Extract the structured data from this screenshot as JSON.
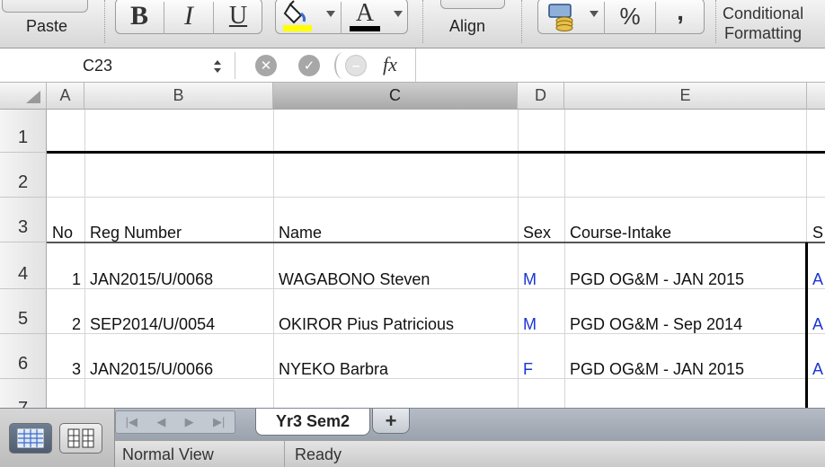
{
  "ribbon": {
    "paste_label": "Paste",
    "bold_label": "B",
    "italic_label": "I",
    "underline_label": "U",
    "font_color_label": "A",
    "align_label": "Align",
    "percent_label": "%",
    "comma_label": ",",
    "conditional_line1": "Conditional",
    "conditional_line2": "Formatting",
    "fill_color": "#ffff00",
    "font_color": "#000000"
  },
  "formula_bar": {
    "cell_ref": "C23",
    "fx_label": "fx",
    "formula_value": ""
  },
  "grid": {
    "columns": [
      "A",
      "B",
      "C",
      "D",
      "E"
    ],
    "selected_column": "C",
    "rows": [
      "1",
      "2",
      "3",
      "4",
      "5",
      "6",
      "7"
    ],
    "header_row": {
      "no": "No",
      "reg": "Reg Number",
      "name": "Name",
      "sex": "Sex",
      "course": "Course-Intake",
      "next": "S"
    },
    "records": [
      {
        "no": "1",
        "reg": "JAN2015/U/0068",
        "name": "WAGABONO Steven",
        "sex": "M",
        "course": "PGD OG&M - JAN 2015",
        "next": "A"
      },
      {
        "no": "2",
        "reg": "SEP2014/U/0054",
        "name": "OKIROR Pius Patricious",
        "sex": "M",
        "course": "PGD OG&M - Sep 2014",
        "next": "A"
      },
      {
        "no": "3",
        "reg": "JAN2015/U/0066",
        "name": "NYEKO Barbra",
        "sex": "F",
        "course": "PGD OG&M - JAN 2015",
        "next": "A"
      }
    ],
    "link_color": "#1a35d6"
  },
  "sheets": {
    "active_tab": "Yr3 Sem2",
    "add_label": "+"
  },
  "status": {
    "view_label": "Normal View",
    "state": "Ready"
  }
}
